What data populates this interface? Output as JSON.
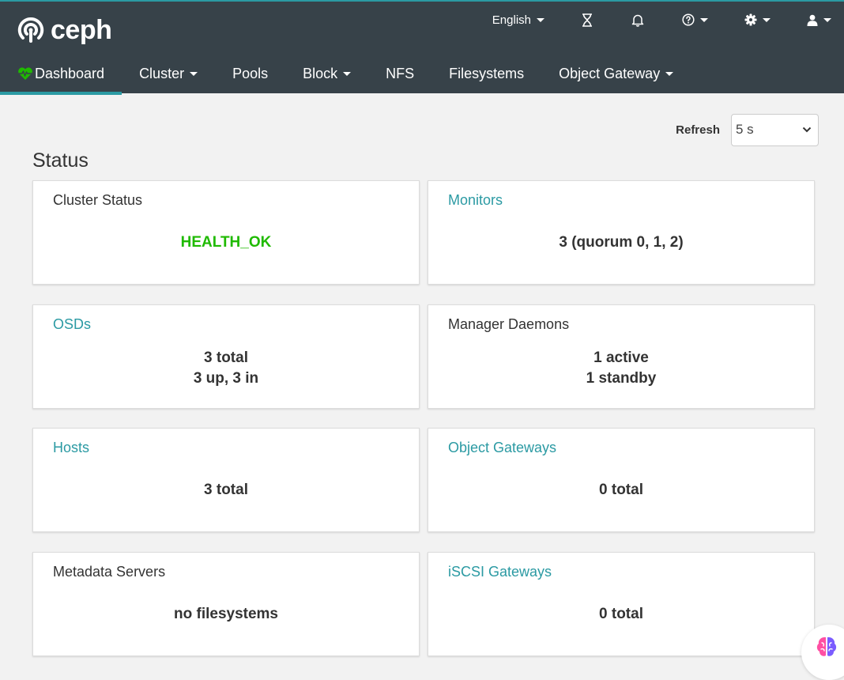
{
  "brand": {
    "name": "ceph"
  },
  "utility": {
    "language": "English",
    "icons": [
      "hourglass-icon",
      "bell-icon",
      "help-icon",
      "settings-icon",
      "user-icon"
    ]
  },
  "nav": {
    "items": [
      {
        "label": "Dashboard",
        "active": true
      },
      {
        "label": "Cluster",
        "dropdown": true
      },
      {
        "label": "Pools"
      },
      {
        "label": "Block",
        "dropdown": true
      },
      {
        "label": "NFS"
      },
      {
        "label": "Filesystems"
      },
      {
        "label": "Object Gateway",
        "dropdown": true
      }
    ]
  },
  "refresh": {
    "label": "Refresh",
    "value": "5 s"
  },
  "status": {
    "title": "Status",
    "cards": {
      "cluster_status": {
        "title": "Cluster Status",
        "value": "HEALTH_OK"
      },
      "monitors": {
        "title": "Monitors",
        "value": "3 (quorum 0, 1, 2)"
      },
      "osds": {
        "title": "OSDs",
        "line1": "3 total",
        "line2": "3 up, 3 in"
      },
      "managers": {
        "title": "Manager Daemons",
        "line1": "1 active",
        "line2": "1 standby"
      },
      "hosts": {
        "title": "Hosts",
        "value": "3 total"
      },
      "object_gateways": {
        "title": "Object Gateways",
        "value": "0 total"
      },
      "metadata_servers": {
        "title": "Metadata Servers",
        "value": "no filesystems"
      },
      "iscsi_gateways": {
        "title": "iSCSI Gateways",
        "value": "0 total"
      }
    }
  },
  "colors": {
    "navbar": "#374249",
    "accent": "#2b9aa3",
    "health_ok": "#1fba00",
    "background": "#f2f2f2"
  }
}
